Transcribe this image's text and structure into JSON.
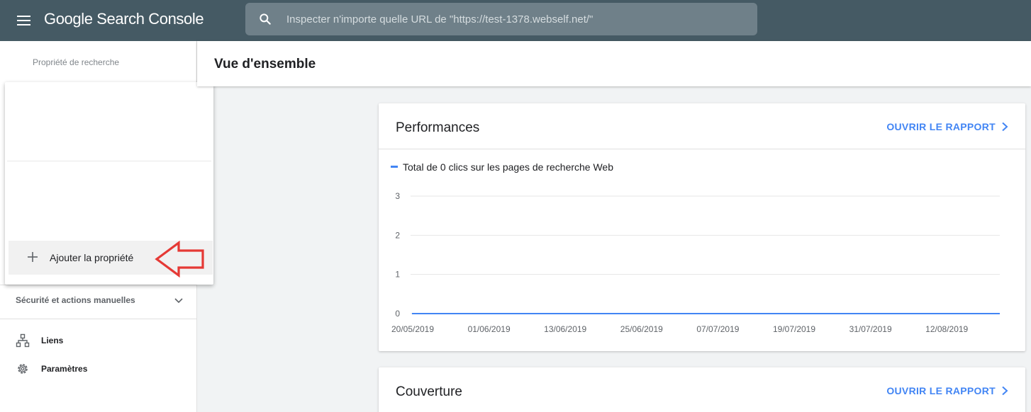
{
  "app": {
    "name": "Google Search Console",
    "menu_icon": "hamburger-menu-icon",
    "search": {
      "placeholder": "Inspecter n'importe quelle URL de \"https://test-1378.webself.net/\"",
      "value": "",
      "icon": "search-icon"
    }
  },
  "sidebar": {
    "property_label": "Propriété de recherche",
    "dropdown": {
      "add_property_label": "Ajouter la propriété",
      "add_icon": "plus-icon"
    },
    "security_section": {
      "label": "Sécurité et actions manuelles",
      "icon": "chevron-down-icon"
    },
    "items": [
      {
        "label": "Liens",
        "icon": "sitemap-icon"
      },
      {
        "label": "Paramètres",
        "icon": "gear-icon"
      }
    ]
  },
  "main": {
    "title": "Vue d'ensemble",
    "cards": [
      {
        "title": "Performances",
        "link": "OUVRIR LE RAPPORT"
      },
      {
        "title": "Couverture",
        "link": "OUVRIR LE RAPPORT"
      }
    ]
  },
  "colors": {
    "topbar": "#455a64",
    "accent": "#4285f4",
    "annotation_arrow": "#e53935"
  },
  "chart_data": {
    "type": "line",
    "x": [
      "20/05/2019",
      "01/06/2019",
      "13/06/2019",
      "25/06/2019",
      "07/07/2019",
      "19/07/2019",
      "31/07/2019",
      "12/08/2019"
    ],
    "series": [
      {
        "name": "Total de 0 clics sur les pages de recherche Web",
        "values": [
          0,
          0,
          0,
          0,
          0,
          0,
          0,
          0
        ]
      }
    ],
    "yticks": [
      0,
      1,
      2,
      3
    ],
    "ylim": [
      0,
      3
    ],
    "grid": true,
    "legend": "top-left"
  }
}
